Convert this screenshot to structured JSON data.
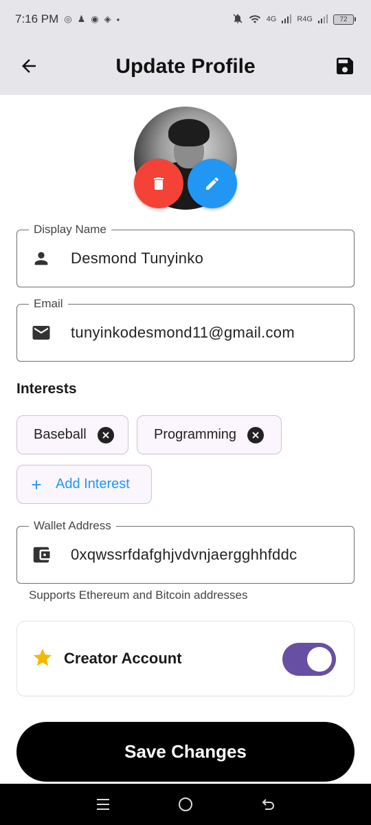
{
  "status_bar": {
    "time": "7:16 PM",
    "network_1": "4G",
    "network_2": "R4G",
    "battery": "72"
  },
  "app_bar": {
    "title": "Update Profile"
  },
  "form": {
    "display_name": {
      "label": "Display Name",
      "value": "Desmond Tunyinko"
    },
    "email": {
      "label": "Email",
      "value": "tunyinkodesmond11@gmail.com"
    },
    "interests": {
      "title": "Interests",
      "items": [
        {
          "label": "Baseball"
        },
        {
          "label": "Programming"
        }
      ],
      "add_label": "Add Interest"
    },
    "wallet": {
      "label": "Wallet Address",
      "value": "0xqwssrfdafghjvdvnjaergghhfddc",
      "helper": "Supports Ethereum and Bitcoin addresses"
    },
    "creator": {
      "label": "Creator Account",
      "enabled": true
    }
  },
  "actions": {
    "save_label": "Save Changes"
  },
  "colors": {
    "delete": "#f44336",
    "edit": "#2196f3",
    "toggle": "#6750a4",
    "star": "#f5b800"
  }
}
